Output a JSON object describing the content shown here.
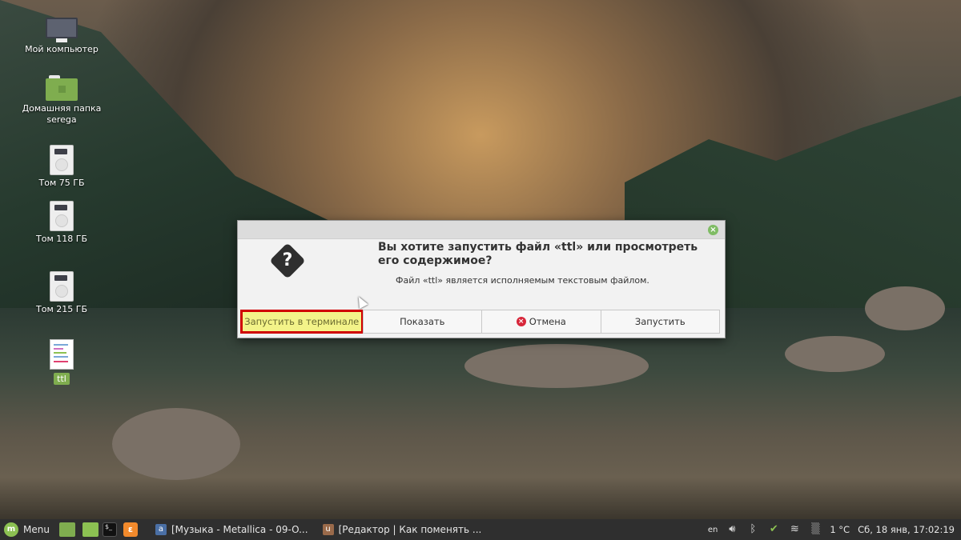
{
  "desktop": {
    "icons": [
      {
        "label": "Мой компьютер",
        "icon": "computer-icon"
      },
      {
        "label": "Домашняя папка serega",
        "icon": "home-folder-icon"
      },
      {
        "label": "Том 75 ГБ",
        "icon": "drive-icon"
      },
      {
        "label": "Том 118 ГБ",
        "icon": "drive-icon"
      },
      {
        "label": "Том 215 ГБ",
        "icon": "drive-icon"
      },
      {
        "label": "ttl",
        "icon": "text-file-icon"
      }
    ]
  },
  "dialog": {
    "title": "Вы хотите запустить файл «ttl» или просмотреть его содержимое?",
    "subtitle": "Файл «ttl» является исполняемым текстовым файлом.",
    "close_icon": "close-icon",
    "icon": "question-icon",
    "buttons": {
      "run_in_terminal": "Запустить в терминале",
      "show": "Показать",
      "cancel": "Отмена",
      "run": "Запустить"
    },
    "highlight_color": "#d00000"
  },
  "taskbar": {
    "menu_label": "Menu",
    "windows": [
      {
        "label": "[Музыка - Metallica - 09-O...",
        "icon": "audio-player-icon"
      },
      {
        "label": "[Редактор | Как поменять ...",
        "icon": "browser-editor-icon"
      }
    ],
    "tray": {
      "keyboard_layout": "en",
      "temperature": "1 °C",
      "clock": "Сб, 18 янв, 17:02:19"
    }
  }
}
